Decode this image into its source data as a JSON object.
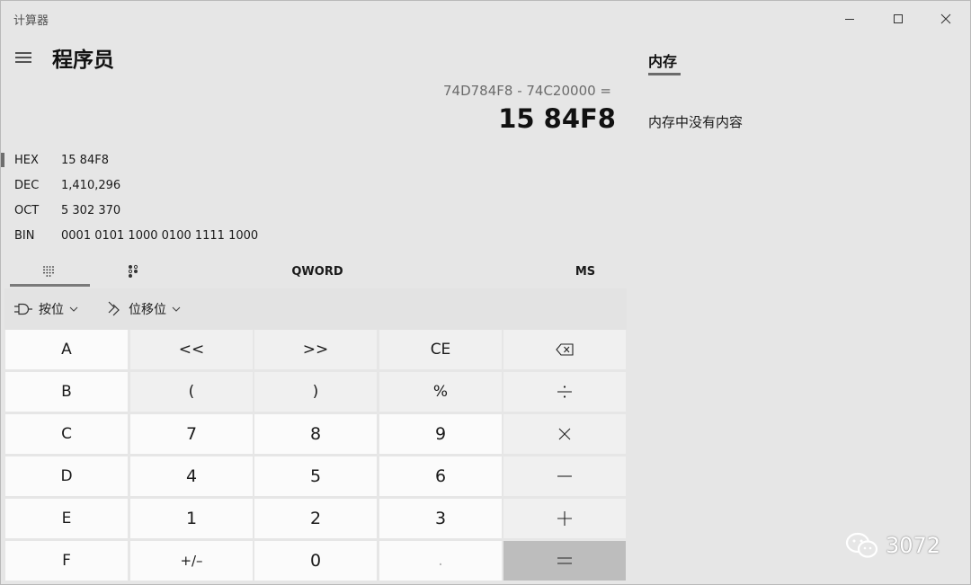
{
  "app_title": "计算器",
  "mode_title": "程序员",
  "display": {
    "expression": "74D784F8 - 74C20000 =",
    "result": "15 84F8"
  },
  "radix": [
    {
      "label": "HEX",
      "value": "15 84F8",
      "active": true
    },
    {
      "label": "DEC",
      "value": "1,410,296",
      "active": false
    },
    {
      "label": "OCT",
      "value": "5 302 370",
      "active": false
    },
    {
      "label": "BIN",
      "value": "0001 0101 1000 0100 1111 1000",
      "active": false
    }
  ],
  "keypad_tabs": {
    "full_keypad_icon": "dot-grid-icon",
    "bit_toggle_icon": "bit-toggle-icon",
    "word_size": "QWORD",
    "memory_store": "MS"
  },
  "bitwise": {
    "bitwise_label": "按位",
    "bitshift_label": "位移位"
  },
  "keys": {
    "A": "A",
    "lshift": "<<",
    "rshift": ">>",
    "CE": "CE",
    "B": "B",
    "lparen": "(",
    "rparen": ")",
    "mod": "%",
    "C": "C",
    "n7": "7",
    "n8": "8",
    "n9": "9",
    "D": "D",
    "n4": "4",
    "n5": "5",
    "n6": "6",
    "E": "E",
    "n1": "1",
    "n2": "2",
    "n3": "3",
    "F": "F",
    "negate": "+/–",
    "n0": "0",
    "decimal": "."
  },
  "memory": {
    "tab_label": "内存",
    "empty_text": "内存中没有内容"
  },
  "watermark": {
    "text": "3072"
  }
}
